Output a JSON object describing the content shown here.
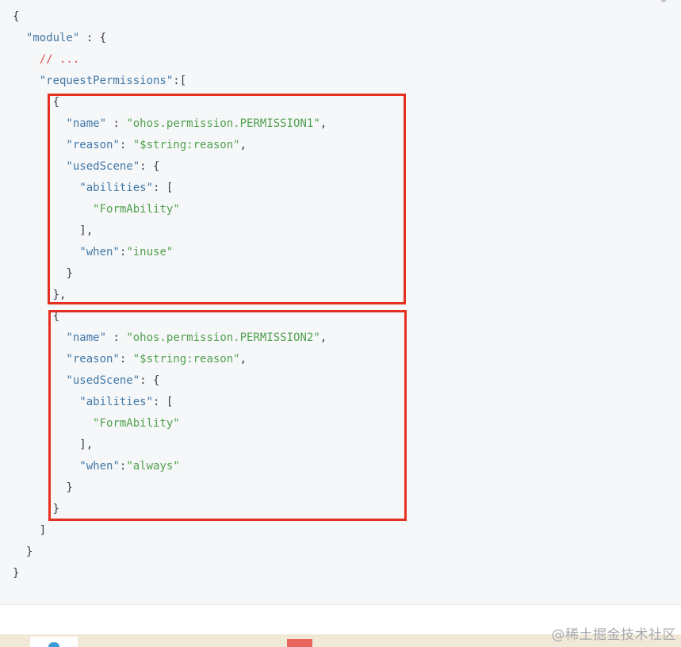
{
  "code_block": {
    "lines": [
      {
        "indent": 0,
        "tokens": [
          {
            "t": "p",
            "v": "{"
          }
        ]
      },
      {
        "indent": 2,
        "tokens": [
          {
            "t": "k",
            "v": "\"module\""
          },
          {
            "t": "p",
            "v": " : {"
          }
        ]
      },
      {
        "indent": 4,
        "tokens": [
          {
            "t": "c",
            "v": "// ..."
          }
        ]
      },
      {
        "indent": 4,
        "tokens": [
          {
            "t": "k",
            "v": "\"requestPermissions\""
          },
          {
            "t": "p",
            "v": ":["
          }
        ]
      },
      {
        "indent": 6,
        "tokens": [
          {
            "t": "p",
            "v": "{"
          }
        ]
      },
      {
        "indent": 8,
        "tokens": [
          {
            "t": "k",
            "v": "\"name\""
          },
          {
            "t": "p",
            "v": " : "
          },
          {
            "t": "s",
            "v": "\"ohos.permission.PERMISSION1\""
          },
          {
            "t": "p",
            "v": ","
          }
        ]
      },
      {
        "indent": 8,
        "tokens": [
          {
            "t": "k",
            "v": "\"reason\""
          },
          {
            "t": "p",
            "v": ": "
          },
          {
            "t": "s",
            "v": "\"$string:reason\""
          },
          {
            "t": "p",
            "v": ","
          }
        ]
      },
      {
        "indent": 8,
        "tokens": [
          {
            "t": "k",
            "v": "\"usedScene\""
          },
          {
            "t": "p",
            "v": ": {"
          }
        ]
      },
      {
        "indent": 10,
        "tokens": [
          {
            "t": "k",
            "v": "\"abilities\""
          },
          {
            "t": "p",
            "v": ": ["
          }
        ]
      },
      {
        "indent": 12,
        "tokens": [
          {
            "t": "s",
            "v": "\"FormAbility\""
          }
        ]
      },
      {
        "indent": 10,
        "tokens": [
          {
            "t": "p",
            "v": "],"
          }
        ]
      },
      {
        "indent": 10,
        "tokens": [
          {
            "t": "k",
            "v": "\"when\""
          },
          {
            "t": "p",
            "v": ":"
          },
          {
            "t": "s",
            "v": "\"inuse\""
          }
        ]
      },
      {
        "indent": 8,
        "tokens": [
          {
            "t": "p",
            "v": "}"
          }
        ]
      },
      {
        "indent": 6,
        "tokens": [
          {
            "t": "p",
            "v": "},"
          }
        ]
      },
      {
        "indent": 6,
        "tokens": [
          {
            "t": "p",
            "v": "{"
          }
        ]
      },
      {
        "indent": 8,
        "tokens": [
          {
            "t": "k",
            "v": "\"name\""
          },
          {
            "t": "p",
            "v": " : "
          },
          {
            "t": "s",
            "v": "\"ohos.permission.PERMISSION2\""
          },
          {
            "t": "p",
            "v": ","
          }
        ]
      },
      {
        "indent": 8,
        "tokens": [
          {
            "t": "k",
            "v": "\"reason\""
          },
          {
            "t": "p",
            "v": ": "
          },
          {
            "t": "s",
            "v": "\"$string:reason\""
          },
          {
            "t": "p",
            "v": ","
          }
        ]
      },
      {
        "indent": 8,
        "tokens": [
          {
            "t": "k",
            "v": "\"usedScene\""
          },
          {
            "t": "p",
            "v": ": {"
          }
        ]
      },
      {
        "indent": 10,
        "tokens": [
          {
            "t": "k",
            "v": "\"abilities\""
          },
          {
            "t": "p",
            "v": ": ["
          }
        ]
      },
      {
        "indent": 12,
        "tokens": [
          {
            "t": "s",
            "v": "\"FormAbility\""
          }
        ]
      },
      {
        "indent": 10,
        "tokens": [
          {
            "t": "p",
            "v": "],"
          }
        ]
      },
      {
        "indent": 10,
        "tokens": [
          {
            "t": "k",
            "v": "\"when\""
          },
          {
            "t": "p",
            "v": ":"
          },
          {
            "t": "s",
            "v": "\"always\""
          }
        ]
      },
      {
        "indent": 8,
        "tokens": [
          {
            "t": "p",
            "v": "}"
          }
        ]
      },
      {
        "indent": 6,
        "tokens": [
          {
            "t": "p",
            "v": "}"
          }
        ]
      },
      {
        "indent": 4,
        "tokens": [
          {
            "t": "p",
            "v": "]"
          }
        ]
      },
      {
        "indent": 2,
        "tokens": [
          {
            "t": "p",
            "v": "}"
          }
        ]
      },
      {
        "indent": 0,
        "tokens": [
          {
            "t": "p",
            "v": "}"
          }
        ]
      }
    ]
  },
  "colors": {
    "key": "#4078a8",
    "string": "#50a14f",
    "comment": "#e04c4c",
    "punct": "#383a42",
    "highlight_border": "#e4301f",
    "panel_bg": "#f6f7f8"
  },
  "icons": {
    "corner": "copy-icon"
  },
  "watermark": {
    "text": "@稀土掘金技术社区"
  }
}
